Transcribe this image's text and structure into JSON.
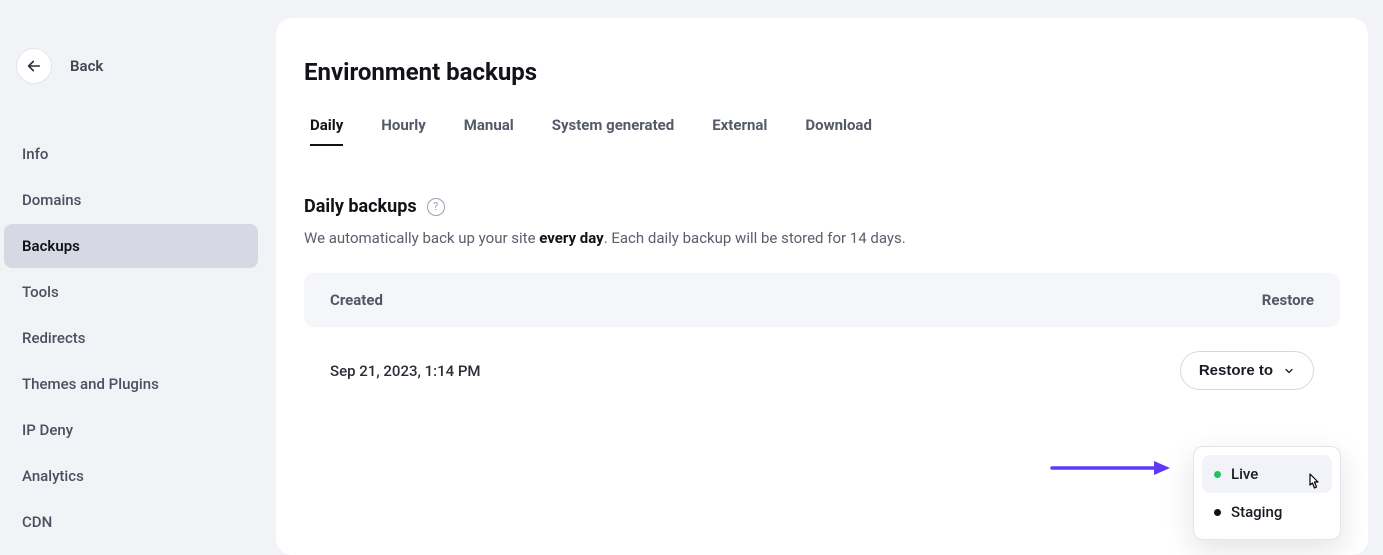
{
  "sidebar": {
    "back_label": "Back",
    "items": [
      {
        "label": "Info"
      },
      {
        "label": "Domains"
      },
      {
        "label": "Backups"
      },
      {
        "label": "Tools"
      },
      {
        "label": "Redirects"
      },
      {
        "label": "Themes and Plugins"
      },
      {
        "label": "IP Deny"
      },
      {
        "label": "Analytics"
      },
      {
        "label": "CDN"
      }
    ],
    "active_index": 2
  },
  "main": {
    "page_title": "Environment backups",
    "tabs": [
      {
        "label": "Daily"
      },
      {
        "label": "Hourly"
      },
      {
        "label": "Manual"
      },
      {
        "label": "System generated"
      },
      {
        "label": "External"
      },
      {
        "label": "Download"
      }
    ],
    "active_tab_index": 0,
    "section_title": "Daily backups",
    "description_pre": "We automatically back up your site ",
    "description_bold": "every day",
    "description_post": ". Each daily backup will be stored for 14 days.",
    "table": {
      "col_created": "Created",
      "col_restore": "Restore",
      "rows": [
        {
          "created": "Sep 21, 2023, 1:14 PM",
          "restore_label": "Restore to"
        }
      ]
    },
    "dropdown": {
      "items": [
        {
          "label": "Live",
          "dot_color": "green",
          "hovered": true
        },
        {
          "label": "Staging",
          "dot_color": "black",
          "hovered": false
        }
      ]
    }
  }
}
